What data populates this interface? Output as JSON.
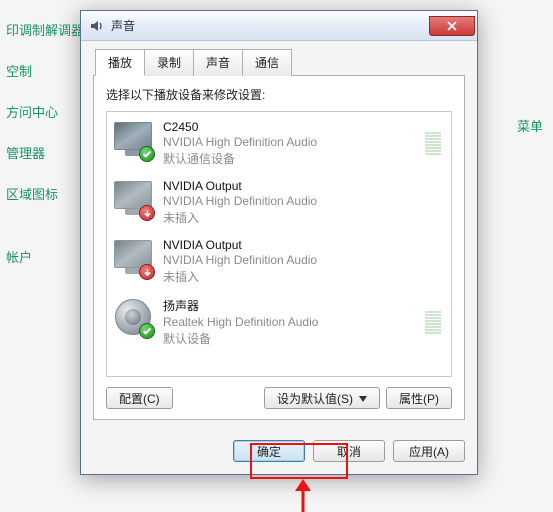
{
  "bg": {
    "links": [
      "印调制解调器",
      "空制",
      "方问中心",
      "管理器",
      "区域图标",
      "",
      "帐户"
    ],
    "right": "菜单"
  },
  "dialog": {
    "title": "声音",
    "close_aria": "close-icon"
  },
  "tabs": [
    {
      "label": "播放",
      "active": true
    },
    {
      "label": "录制",
      "active": false
    },
    {
      "label": "声音",
      "active": false
    },
    {
      "label": "通信",
      "active": false
    }
  ],
  "panel": {
    "description": "选择以下播放设备来修改设置:"
  },
  "devices": [
    {
      "name": "C2450",
      "detail": "NVIDIA High Definition Audio",
      "status": "默认通信设备",
      "icon": "monitor",
      "badge": "ok",
      "meter": true
    },
    {
      "name": "NVIDIA Output",
      "detail": "NVIDIA High Definition Audio",
      "status": "未插入",
      "icon": "monitor",
      "badge": "down",
      "meter": false
    },
    {
      "name": "NVIDIA Output",
      "detail": "NVIDIA High Definition Audio",
      "status": "未插入",
      "icon": "monitor",
      "badge": "down",
      "meter": false
    },
    {
      "name": "扬声器",
      "detail": "Realtek High Definition Audio",
      "status": "默认设备",
      "icon": "speaker",
      "badge": "ok",
      "meter": true
    }
  ],
  "panel_buttons": {
    "configure": "配置(C)",
    "set_default": "设为默认值(S)",
    "properties": "属性(P)"
  },
  "bottom_buttons": {
    "ok": "确定",
    "cancel": "取消",
    "apply": "应用(A)"
  }
}
